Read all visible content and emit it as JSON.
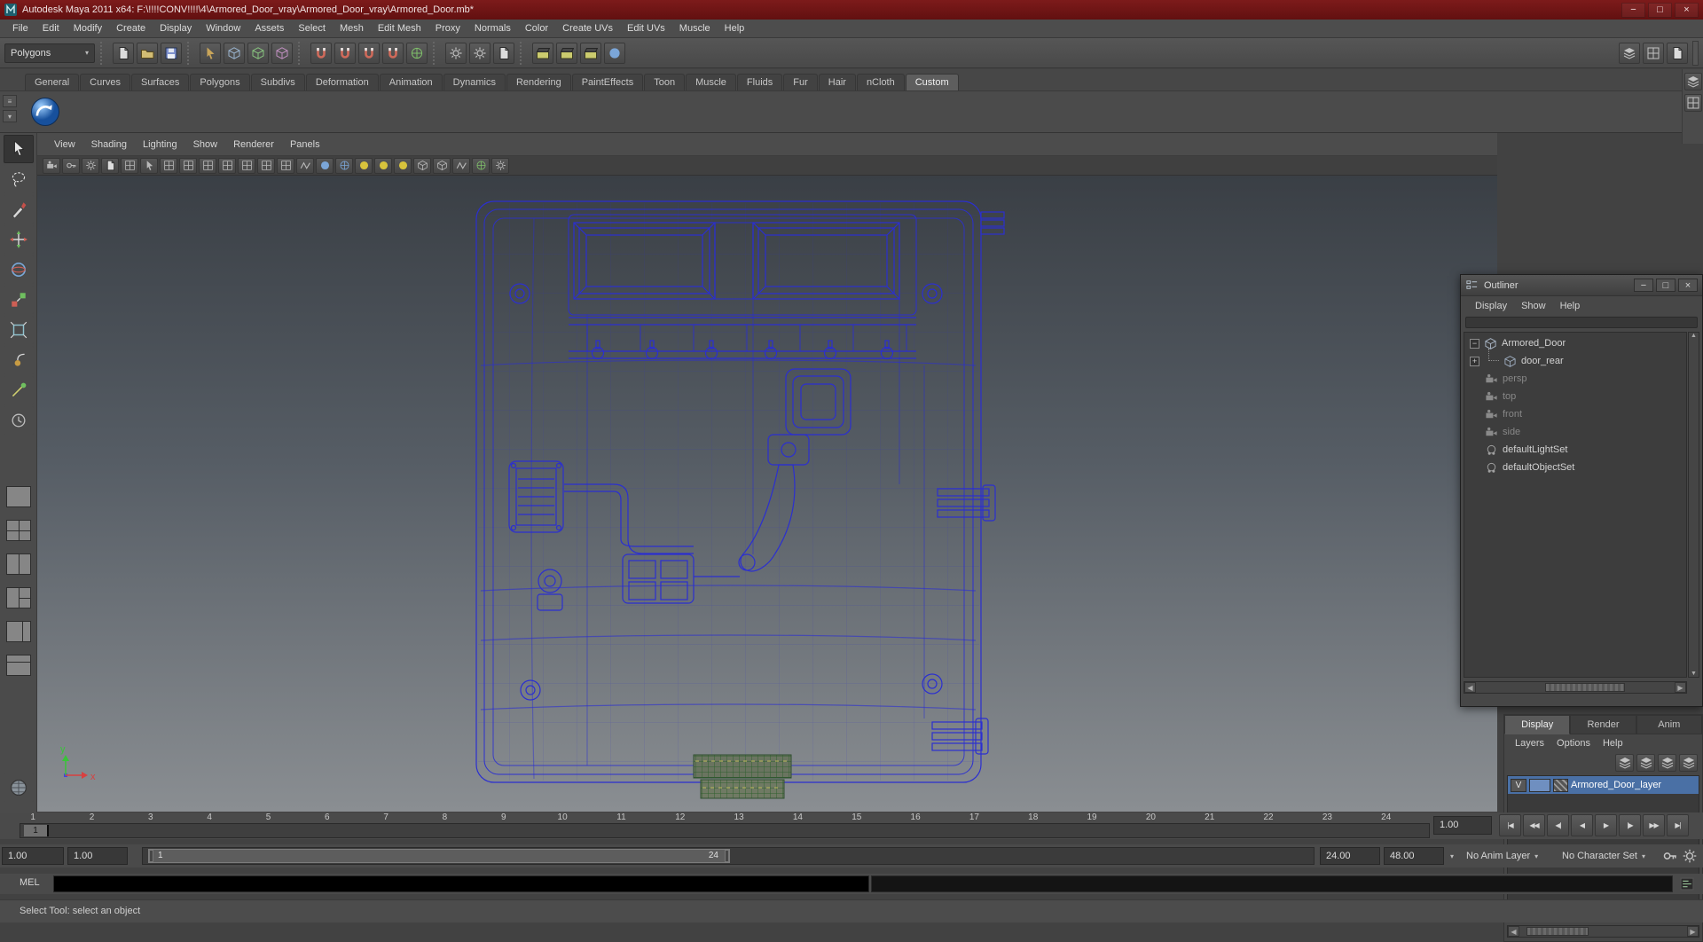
{
  "window": {
    "title": "Autodesk Maya 2011 x64: F:\\!!!!CONV!!!!\\4\\Armored_Door_vray\\Armored_Door_vray\\Armored_Door.mb*"
  },
  "menu_bar": {
    "items": [
      "File",
      "Edit",
      "Modify",
      "Create",
      "Display",
      "Window",
      "Assets",
      "Select",
      "Mesh",
      "Edit Mesh",
      "Proxy",
      "Normals",
      "Color",
      "Create UVs",
      "Edit UVs",
      "Muscle",
      "Help"
    ]
  },
  "status_line": {
    "mode": "Polygons"
  },
  "shelf": {
    "tabs": [
      "General",
      "Curves",
      "Surfaces",
      "Polygons",
      "Subdivs",
      "Deformation",
      "Animation",
      "Dynamics",
      "Rendering",
      "PaintEffects",
      "Toon",
      "Muscle",
      "Fluids",
      "Fur",
      "Hair",
      "nCloth",
      "Custom"
    ],
    "active_tab": "Custom"
  },
  "panel": {
    "menus": [
      "View",
      "Shading",
      "Lighting",
      "Show",
      "Renderer",
      "Panels"
    ],
    "axis": {
      "x": "x",
      "y": "y"
    }
  },
  "outliner": {
    "title": "Outliner",
    "menus": [
      "Display",
      "Show",
      "Help"
    ],
    "items": [
      {
        "label": "Armored_Door"
      },
      {
        "label": "door_rear"
      },
      {
        "label": "persp"
      },
      {
        "label": "top"
      },
      {
        "label": "front"
      },
      {
        "label": "side"
      },
      {
        "label": "defaultLightSet"
      },
      {
        "label": "defaultObjectSet"
      }
    ]
  },
  "layer_editor": {
    "tabs": [
      "Display",
      "Render",
      "Anim"
    ],
    "active_tab": "Display",
    "menus": [
      "Layers",
      "Options",
      "Help"
    ],
    "layer": {
      "visibility": "V",
      "name": "Armored_Door_layer"
    }
  },
  "time_slider": {
    "ticks": [
      "1",
      "2",
      "3",
      "4",
      "5",
      "6",
      "7",
      "8",
      "9",
      "10",
      "11",
      "12",
      "13",
      "14",
      "15",
      "16",
      "17",
      "18",
      "19",
      "20",
      "21",
      "22",
      "23",
      "24"
    ],
    "current_frame": "1",
    "frame_field": "1.00"
  },
  "range_slider": {
    "anim_start": "1.00",
    "playback_start": "1.00",
    "range_label_start": "1",
    "range_label_end": "24",
    "playback_end": "24.00",
    "anim_end": "48.00",
    "anim_layer": "No Anim Layer",
    "character_set": "No Character Set"
  },
  "command_line": {
    "label": "MEL"
  },
  "help_line": {
    "text": "Select Tool: select an object"
  },
  "icons": {
    "minimize": "−",
    "maximize": "□",
    "close": "×",
    "caret_down": "▼",
    "caret_small": "▾",
    "arrow_left": "◀",
    "arrow_right": "▶",
    "arrow_up": "▲",
    "arrow_down": "▼",
    "expand_open": "−",
    "expand_closed": "+",
    "menu_grip": "≡",
    "playback": [
      "|◀",
      "◀◀",
      "◀|",
      "◀",
      "▶",
      "|▶",
      "▶▶",
      "▶|"
    ]
  },
  "colors": {
    "titlebar": "#7d1b1b",
    "wireframe": "#2b2fd0",
    "selected_layer": "#4a70a5",
    "viewport_top": "#3a3f45",
    "viewport_bottom": "#8a8e92"
  }
}
